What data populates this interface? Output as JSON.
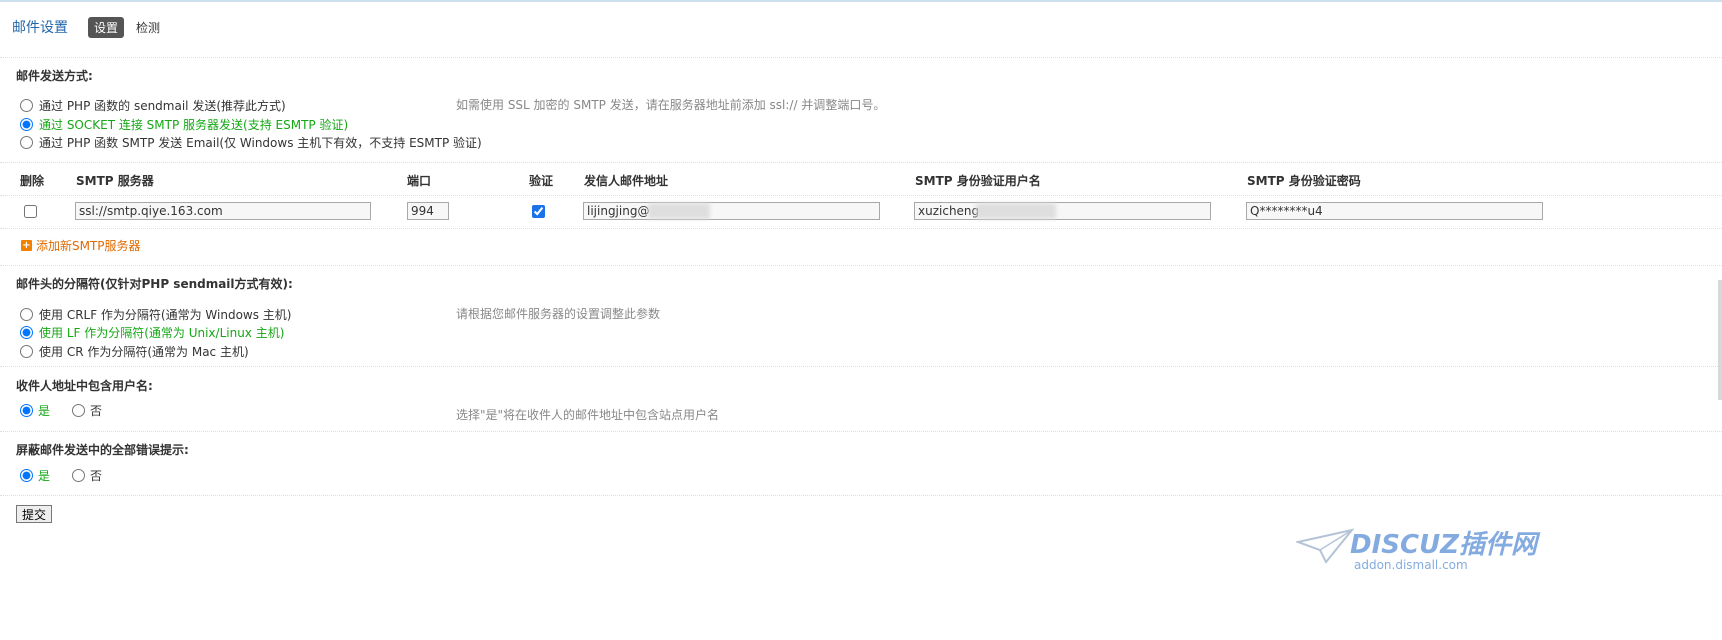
{
  "header": {
    "title": "邮件设置",
    "tabs": [
      {
        "label": "设置",
        "active": true
      },
      {
        "label": "检测",
        "active": false
      }
    ]
  },
  "send_method": {
    "heading": "邮件发送方式:",
    "options": [
      {
        "label": "通过 PHP 函数的 sendmail 发送(推荐此方式)",
        "selected": false
      },
      {
        "label": "通过 SOCKET 连接 SMTP 服务器发送(支持 ESMTP 验证)",
        "selected": true
      },
      {
        "label": "通过 PHP 函数 SMTP 发送 Email(仅 Windows 主机下有效，不支持 ESMTP 验证)",
        "selected": false
      }
    ],
    "hint": "如需使用 SSL 加密的 SMTP 发送，请在服务器地址前添加 ssl:// 并调整端口号。"
  },
  "smtp_table": {
    "columns": {
      "delete": "删除",
      "server": "SMTP 服务器",
      "port": "端口",
      "auth": "验证",
      "from": "发信人邮件地址",
      "user": "SMTP 身份验证用户名",
      "password": "SMTP 身份验证密码"
    },
    "row": {
      "delete_checked": false,
      "server": "ssl://smtp.qiye.163.com",
      "port": "994",
      "auth_checked": true,
      "from": "lijingjing@",
      "user": "xuzicheng",
      "password": "Q********u4"
    },
    "add_label": "添加新SMTP服务器"
  },
  "separator": {
    "heading": "邮件头的分隔符(仅针对PHP sendmail方式有效):",
    "options": [
      {
        "label": "使用 CRLF 作为分隔符(通常为 Windows 主机)",
        "selected": false
      },
      {
        "label": "使用 LF 作为分隔符(通常为 Unix/Linux 主机)",
        "selected": true
      },
      {
        "label": "使用 CR 作为分隔符(通常为 Mac 主机)",
        "selected": false
      }
    ],
    "hint": "请根据您邮件服务器的设置调整此参数"
  },
  "include_username": {
    "heading": "收件人地址中包含用户名:",
    "yes": "是",
    "no": "否",
    "value": "yes",
    "hint": "选择\"是\"将在收件人的邮件地址中包含站点用户名"
  },
  "suppress_errors": {
    "heading": "屏蔽邮件发送中的全部错误提示:",
    "yes": "是",
    "no": "否",
    "value": "yes"
  },
  "submit_label": "提交",
  "watermark": {
    "brand": "DISCUZ插件网",
    "url": "addon.dismall.com"
  }
}
